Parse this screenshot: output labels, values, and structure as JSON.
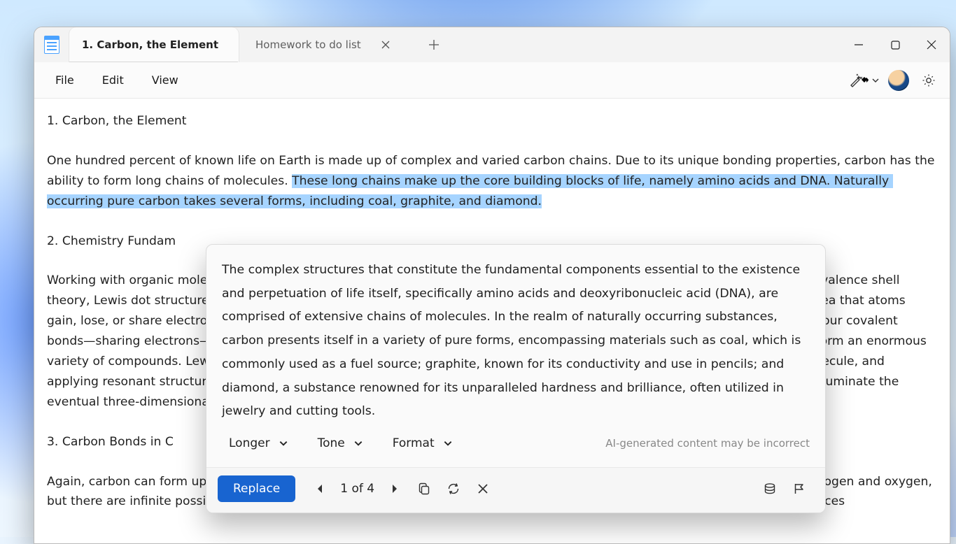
{
  "window": {
    "tabs": [
      {
        "title": "1. Carbon, the Element",
        "active": true,
        "closeable": false
      },
      {
        "title": "Homework to do list",
        "active": false,
        "closeable": true
      }
    ]
  },
  "menubar": {
    "file": "File",
    "edit": "Edit",
    "view": "View"
  },
  "document": {
    "h1": "1. Carbon, the Element",
    "p1a": "One hundred percent of known life on Earth is made up of complex and varied carbon chains. Due to its unique bonding properties, carbon has the ability to form long chains of molecules. ",
    "p1_sel": "These long chains make up the core building blocks of life, namely amino acids and DNA. Naturally occurring pure carbon takes several forms, including coal, graphite, and diamond.",
    "h2": "2. Chemistry Fundam",
    "p2": "Working with organic molecules requires mastering some fundamental chemical concepts first. We will provide a brief review of valence shell theory, Lewis dot structures, and molecular shape. Carbon's versatile bonding properties stem from valence shell theory—the idea that atoms gain, lose, or share electrons to complete their outer shells. Carbon, owing to the four electrons in its outer shell, seeks to form four covalent bonds—sharing electrons—to complete its outer shell bonds with other atoms or molecules. This tetravalence allows carbon to form an enormous variety of compounds. Lewis dot structures play a pivotal role in determining the possible arrangements of atoms in a given molecule, and applying resonant structures) can help predict the most stable configuration. From there, understanding orbital shells can help illuminate the eventual three-dimensional shape a molecule takes. Knowing the shape of a molecule can tell us its basic shape.",
    "h3": "3. Carbon Bonds in C",
    "p3": "Again, carbon can form up to four bonds with other molecules. In organic chemistry, we mainly focus on carbon chains with hydrogen and oxygen, but there are infinite possible compounds. In the simplest form, carbon bonds with four hydrogen in single bonds. In other instances"
  },
  "popup": {
    "suggestion": "The complex structures that constitute the fundamental components essential to the existence and perpetuation of life itself, specifically amino acids and deoxyribonucleic acid (DNA), are comprised of extensive chains of molecules. In the realm of naturally occurring substances, carbon presents itself in a variety of pure forms, encompassing materials such as coal, which is commonly used as a fuel source; graphite, known for its conductivity and use in pencils; and diamond, a substance renowned for its unparalleled hardness and brilliance, often utilized in jewelry and cutting tools.",
    "options": {
      "length": "Longer",
      "tone": "Tone",
      "format": "Format"
    },
    "disclaimer": "AI-generated content may be incorrect",
    "replace_label": "Replace",
    "pager": "1 of 4"
  }
}
